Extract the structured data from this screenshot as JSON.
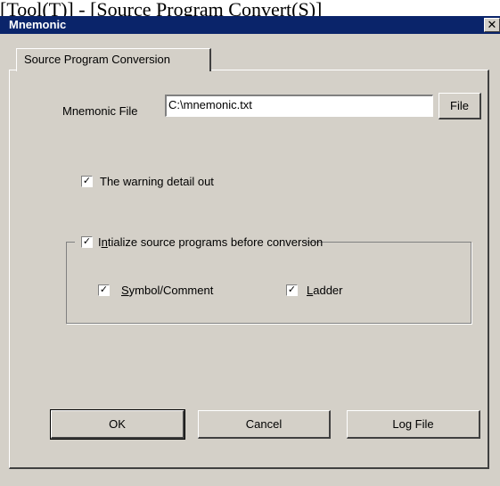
{
  "caption": {
    "text": "[Tool(T)] - [Source Program Convert(S)]"
  },
  "window": {
    "title": "Mnemonic",
    "close_glyph": "✕"
  },
  "tab": {
    "label": "Source Program Conversion"
  },
  "mnemonic_file": {
    "label": "Mnemonic File",
    "value": "C:\\mnemonic.txt",
    "button": "File"
  },
  "options": {
    "warning_detail": {
      "label": "The warning detail out",
      "checked": true
    },
    "initialize": {
      "prefix": "I",
      "mnemonic": "n",
      "rest": "tialize source programs before conversion",
      "checked": true
    },
    "symbol_comment": {
      "mnemonic": "S",
      "rest": "ymbol/Comment",
      "checked": true
    },
    "ladder": {
      "mnemonic": "L",
      "rest": "adder",
      "checked": true
    }
  },
  "buttons": {
    "ok": "OK",
    "cancel": "Cancel",
    "log_file": "Log File"
  },
  "icons": {
    "close": "close-icon",
    "check": "checkmark-icon"
  },
  "colors": {
    "titlebar": "#0a246a",
    "face": "#d4d0c8"
  }
}
